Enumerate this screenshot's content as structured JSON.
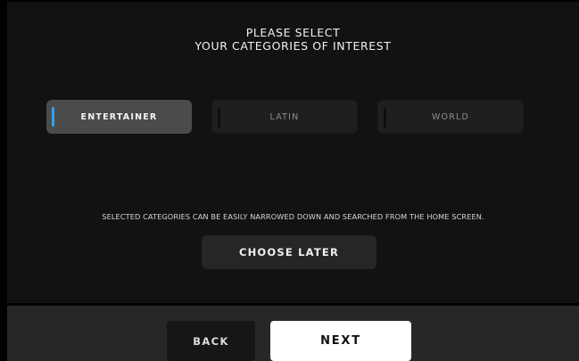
{
  "header": {
    "title_line1": "PLEASE SELECT",
    "title_line2": "YOUR CATEGORIES OF INTEREST"
  },
  "categories": [
    {
      "label": "ENTERTAINER",
      "selected": true
    },
    {
      "label": "LATIN",
      "selected": false
    },
    {
      "label": "WORLD",
      "selected": false
    }
  ],
  "info_text": "SELECTED CATEGORIES CAN BE EASILY NARROWED DOWN AND SEARCHED FROM THE HOME SCREEN.",
  "choose_later_label": "CHOOSE LATER",
  "footer": {
    "back_label": "BACK",
    "next_label": "NEXT"
  },
  "colors": {
    "accent": "#2fa0f0",
    "background": "#000000",
    "panel": "#121212",
    "footer": "#272727",
    "selected_tile": "#4b4b4b",
    "unselected_tile": "#1f1f1f",
    "next_button": "#ffffff"
  }
}
